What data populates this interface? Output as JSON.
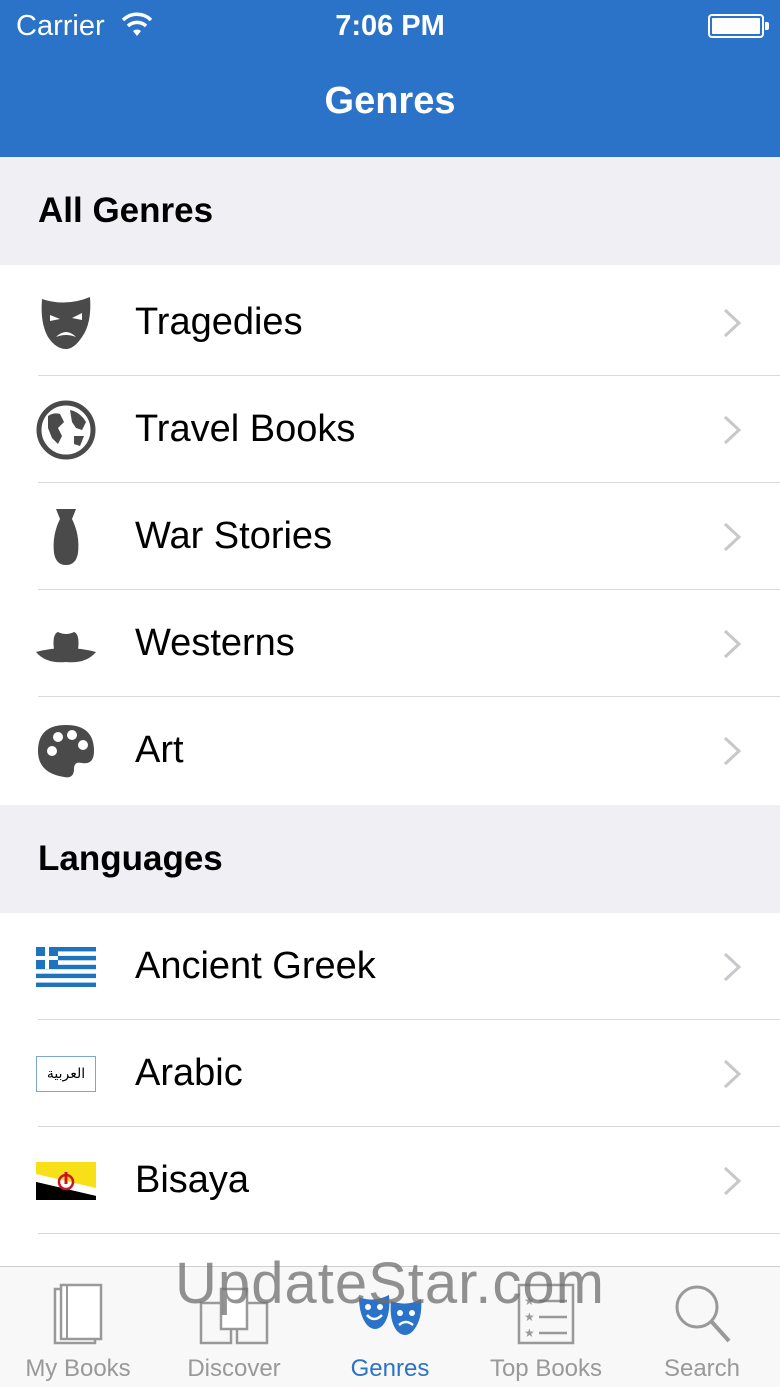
{
  "status": {
    "carrier": "Carrier",
    "time": "7:06 PM"
  },
  "nav": {
    "title": "Genres"
  },
  "sections": {
    "all_genres": {
      "title": "All Genres",
      "items": [
        {
          "label": "Tragedies",
          "icon": "tragedy-mask-icon"
        },
        {
          "label": "Travel Books",
          "icon": "globe-icon"
        },
        {
          "label": "War Stories",
          "icon": "bomb-icon"
        },
        {
          "label": "Westerns",
          "icon": "cowboy-hat-icon"
        },
        {
          "label": "Art",
          "icon": "palette-icon"
        }
      ]
    },
    "languages": {
      "title": "Languages",
      "items": [
        {
          "label": "Ancient Greek",
          "icon": "greece-flag-icon"
        },
        {
          "label": "Arabic",
          "icon": "arabic-script-icon",
          "icon_text": "العربية"
        },
        {
          "label": "Bisaya",
          "icon": "brunei-flag-icon"
        }
      ]
    }
  },
  "tabs": [
    {
      "label": "My Books",
      "icon": "books-icon"
    },
    {
      "label": "Discover",
      "icon": "discover-icon"
    },
    {
      "label": "Genres",
      "icon": "theater-masks-icon",
      "active": true
    },
    {
      "label": "Top Books",
      "icon": "top-list-icon"
    },
    {
      "label": "Search",
      "icon": "search-icon"
    }
  ],
  "watermark": "UpdateStar.com",
  "colors": {
    "accent": "#2a73c9",
    "section_bg": "#efeff4",
    "icon_gray": "#4a4a4a"
  }
}
